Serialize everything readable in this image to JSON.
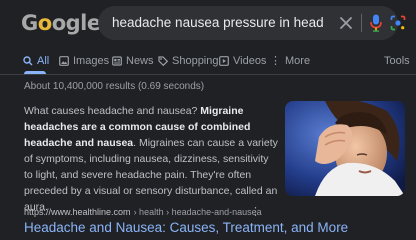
{
  "search": {
    "logo": "Google",
    "query": "headache nausea pressure in head"
  },
  "tabs": [
    {
      "label": "All",
      "icon": "search-icon",
      "active": true
    },
    {
      "label": "Images",
      "icon": "image-icon",
      "active": false
    },
    {
      "label": "News",
      "icon": "news-icon",
      "active": false
    },
    {
      "label": "Shopping",
      "icon": "tag-icon",
      "active": false
    },
    {
      "label": "Videos",
      "icon": "play-icon",
      "active": false
    },
    {
      "label": "More",
      "icon": "more-vert-icon",
      "active": false
    },
    {
      "label": "Tools",
      "icon": "",
      "active": false
    }
  ],
  "stats": "About 10,400,000 results (0.69 seconds)",
  "snippet": {
    "lead": "What causes headache and nausea? ",
    "bold": "Migraine headaches are a common cause of combined headache and nausea",
    "rest": ". Migraines can cause a variety of symptoms, including nausea, dizziness, sensitivity to light, and severe headache pain. They're often preceded by a visual or sensory disturbance, called an aura."
  },
  "result": {
    "domain": "https://www.healthline.com",
    "crumbs": "› health › headache-and-nausea",
    "more": "⋮",
    "title": "Headache and Nausea: Causes, Treatment, and More"
  },
  "colors": {
    "background": "#202124",
    "link": "#8ab4f8",
    "text": "#bdc1c6",
    "muted": "#9aa0a6"
  }
}
